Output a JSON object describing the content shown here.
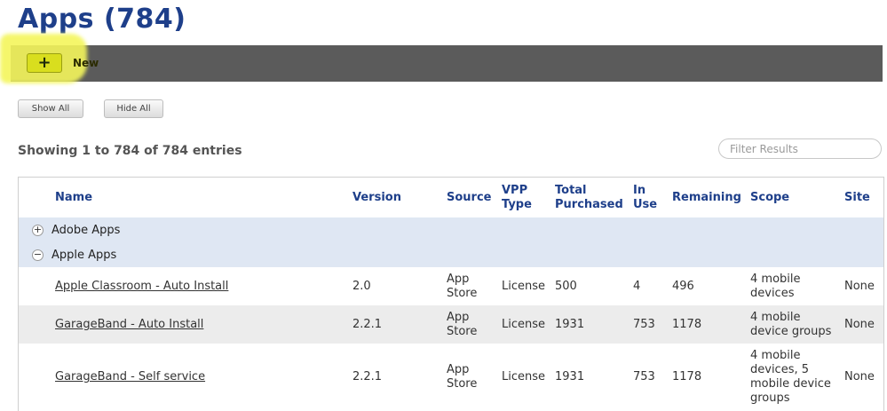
{
  "page": {
    "title": "Apps (784)"
  },
  "toolbar": {
    "new_icon": "+",
    "new_label": "New"
  },
  "buttons": {
    "show_all": "Show All",
    "hide_all": "Hide All"
  },
  "summary": "Showing 1 to 784 of 784 entries",
  "filter": {
    "placeholder": "Filter Results"
  },
  "table": {
    "headers": {
      "name": "Name",
      "version": "Version",
      "source": "Source",
      "vpp_type_line1": "VPP",
      "vpp_type_line2": "Type",
      "total_line1": "Total",
      "total_line2": "Purchased",
      "inuse_line1": "In",
      "inuse_line2": "Use",
      "remaining": "Remaining",
      "scope": "Scope",
      "site": "Site"
    },
    "groups": [
      {
        "label": "Adobe Apps",
        "toggle": "+"
      },
      {
        "label": "Apple Apps",
        "toggle": "−"
      }
    ],
    "rows": [
      {
        "name": "Apple Classroom - Auto Install",
        "version": "2.0",
        "source_line1": "App",
        "source_line2": "Store",
        "vpp_type": "License",
        "total": "500",
        "in_use": "4",
        "remaining": "496",
        "scope_lines": [
          "4 mobile",
          "devices"
        ],
        "site": "None"
      },
      {
        "name": "GarageBand - Auto Install",
        "version": "2.2.1",
        "source_line1": "App",
        "source_line2": "Store",
        "vpp_type": "License",
        "total": "1931",
        "in_use": "753",
        "remaining": "1178",
        "scope_lines": [
          "4 mobile",
          "device groups"
        ],
        "site": "None"
      },
      {
        "name": "GarageBand - Self service",
        "version": "2.2.1",
        "source_line1": "App",
        "source_line2": "Store",
        "vpp_type": "License",
        "total": "1931",
        "in_use": "753",
        "remaining": "1178",
        "scope_lines": [
          "4 mobile",
          "devices, 5",
          "mobile device",
          "groups"
        ],
        "site": "None"
      }
    ]
  },
  "colors": {
    "title": "#1e3f8a",
    "toolbar": "#5b5b5b",
    "highlight": "#f4f65c",
    "group_row": "#dfe7f3",
    "alt_row": "#ececec"
  }
}
